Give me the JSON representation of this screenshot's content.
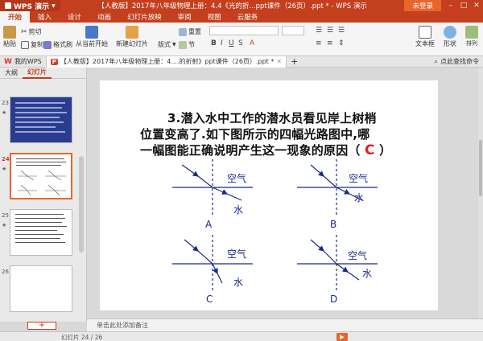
{
  "titlebar": {
    "app_name": "WPS 演示",
    "window_title": "【人教版】2017年八年级物理上册：4.4《光的折...ppt课件（26页）.ppt * - WPS 演示",
    "login_label": "未登录",
    "min_glyph": "–",
    "max_glyph": "□",
    "close_glyph": "✕"
  },
  "menu": {
    "tabs": [
      "开始",
      "插入",
      "设计",
      "动画",
      "幻灯片放映",
      "审阅",
      "视图",
      "云服务"
    ]
  },
  "ribbon": {
    "paste": "粘贴",
    "cut": "剪切",
    "copy": "复制",
    "format_painter": "格式刷",
    "play_from_current": "从当前开始",
    "new_slide": "新建幻灯片",
    "layout": "版式",
    "reset": "重置",
    "section": "节",
    "font_name": "",
    "font_size": "",
    "textbox": "文本框",
    "shape": "形状",
    "arrange": "排列"
  },
  "doc_tabs": {
    "wps_home": "我的WPS",
    "active_doc": "【人教版】2017年八年级物理上册：4....的折射》ppt课件（26页）.ppt *",
    "add_glyph": "+",
    "search_placeholder": "点此查找命令"
  },
  "left_panel": {
    "tab_outline": "大纲",
    "tab_slides": "幻灯片",
    "slide_numbers": [
      "23",
      "24",
      "25",
      "26"
    ],
    "star_glyph": "★",
    "add_glyph": "+"
  },
  "slide": {
    "line1": "3.潜入水中工作的潜水员看见岸上树梢",
    "line2": "位置变高了.如下图所示的四幅光路图中,哪",
    "line3": "一幅图能正确说明产生这一现象的原因（",
    "answer": "C",
    "close_paren": "）",
    "diagrams": [
      {
        "label": "A",
        "air": "空气",
        "water": "水"
      },
      {
        "label": "B",
        "air": "空气",
        "water": "水"
      },
      {
        "label": "C",
        "air": "空气",
        "water": "水"
      },
      {
        "label": "D",
        "air": "空气",
        "water": "水"
      }
    ]
  },
  "notes": {
    "placeholder": "单击此处添加备注"
  },
  "status": {
    "slide_counter": "幻灯片 24 / 26",
    "play_glyph": "▶"
  }
}
